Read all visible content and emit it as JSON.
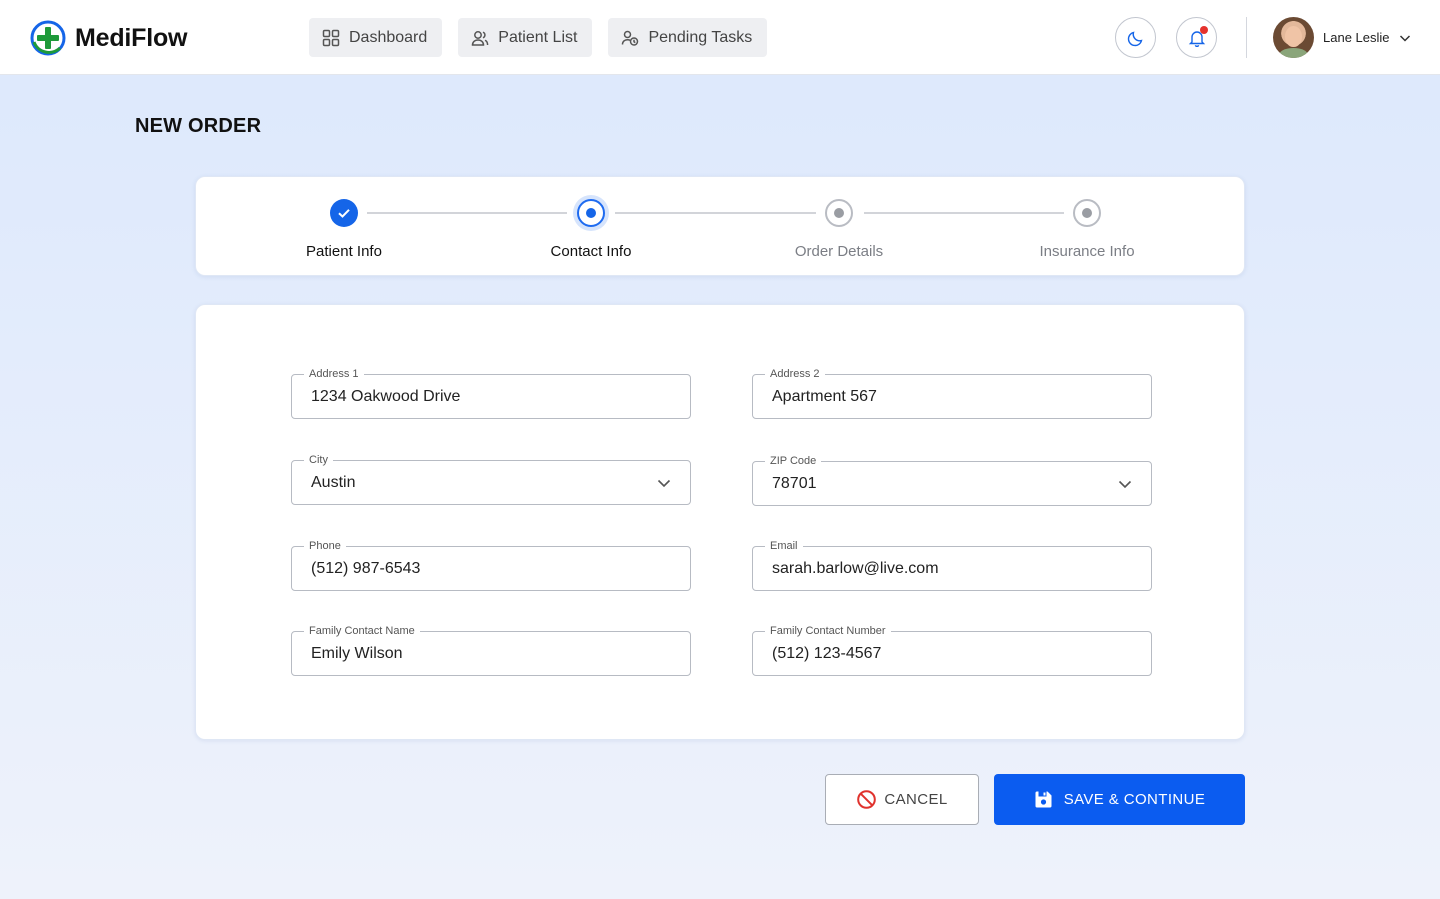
{
  "app": {
    "name": "MediFlow",
    "logo_icon": "plus-cross-icon",
    "brand_colors": {
      "green": "#1e9a3a",
      "blue": "#1565e8"
    }
  },
  "nav": [
    {
      "label": "Dashboard",
      "icon": "grid-icon"
    },
    {
      "label": "Patient List",
      "icon": "users-icon"
    },
    {
      "label": "Pending Tasks",
      "icon": "tasks-icon"
    }
  ],
  "header": {
    "theme_toggle_icon": "moon-icon",
    "notifications_icon": "bell-icon",
    "has_unread_notifications": true
  },
  "user": {
    "name": "Lane Leslie",
    "menu_icon": "chevron-down-icon"
  },
  "page": {
    "title": "NEW ORDER"
  },
  "stepper": {
    "steps": [
      {
        "label": "Patient Info",
        "status": "completed"
      },
      {
        "label": "Contact Info",
        "status": "active"
      },
      {
        "label": "Order Details",
        "status": "pending"
      },
      {
        "label": "Insurance Info",
        "status": "pending"
      }
    ]
  },
  "form": {
    "address1": {
      "label": "Address 1",
      "value": "1234 Oakwood Drive"
    },
    "address2": {
      "label": "Address 2",
      "value": "Apartment 567"
    },
    "city": {
      "label": "City",
      "value": "Austin",
      "type": "select"
    },
    "zip": {
      "label": "ZIP Code",
      "value": "78701",
      "type": "select"
    },
    "phone": {
      "label": "Phone",
      "value": "(512) 987-6543"
    },
    "email": {
      "label": "Email",
      "value": "sarah.barlow@live.com"
    },
    "family_name": {
      "label": "Family Contact Name",
      "value": "Emily Wilson"
    },
    "family_number": {
      "label": "Family Contact Number",
      "value": "(512) 123-4567"
    }
  },
  "actions": {
    "cancel": {
      "label": "CANCEL",
      "icon": "no-entry-icon",
      "color": "#e0322d"
    },
    "save": {
      "label": "SAVE & CONTINUE",
      "icon": "floppy-disk-icon",
      "color": "#0b5cf0"
    }
  }
}
